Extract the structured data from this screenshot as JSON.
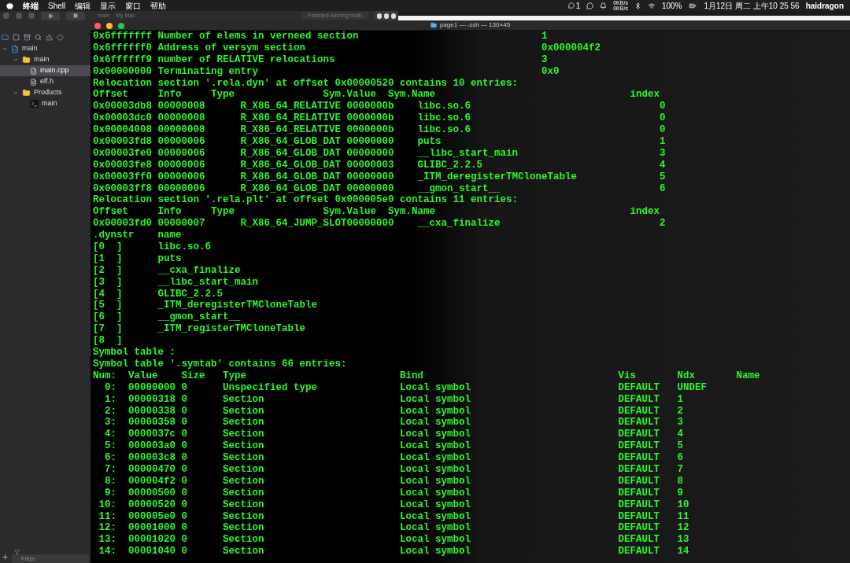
{
  "menu_bar": {
    "menus": [
      "终端",
      "Shell",
      "编辑",
      "显示",
      "窗口",
      "帮助"
    ],
    "badge": "1",
    "net_up": "0KB/s",
    "net_down": "0KB/s",
    "battery": "100%",
    "clock": "1月12日 周二 上午10 25 56",
    "user": "haidragon"
  },
  "xcode_toolbar": {
    "scheme": "main",
    "destination": "My Mac",
    "status": "Finished running main"
  },
  "navigator": {
    "tree": [
      {
        "label": "main",
        "kind": "project",
        "selected": false,
        "expanded": true,
        "children": [
          {
            "label": "main",
            "kind": "folder",
            "selected": false,
            "expanded": true,
            "children": [
              {
                "label": "main.cpp",
                "kind": "cpp",
                "selected": true
              },
              {
                "label": "elf.h",
                "kind": "header",
                "selected": false
              }
            ]
          },
          {
            "label": "Products",
            "kind": "folder",
            "selected": false,
            "expanded": true,
            "children": [
              {
                "label": "main",
                "kind": "executable",
                "selected": false
              }
            ]
          }
        ]
      }
    ],
    "filter": {
      "placeholder": "Filter"
    }
  },
  "terminal": {
    "title": "page1 — -zsh — 130×45",
    "blocks": [
      {
        "kind": "dynamic",
        "rows": [
          [
            "0x6fffffff",
            "Number of elems in verneed section",
            "1"
          ],
          [
            "0x6ffffff0",
            "Address of versym section",
            "0x000004f2"
          ],
          [
            "0x6ffffff9",
            "number of RELATIVE relocations",
            "3"
          ],
          [
            "0x00000000",
            "Terminating entry",
            "0x0"
          ]
        ]
      },
      {
        "kind": "heading",
        "text": "Relocation section '.rela.dyn' at offset 0x00000520 contains 10 entries:"
      },
      {
        "kind": "reloc",
        "header": [
          "Offset",
          "Info",
          "Type",
          "Sym.Value",
          "Sym.Name",
          "index"
        ],
        "rows": [
          [
            "0x00003db8",
            "00000008",
            "R_X86_64_RELATIVE",
            "0000000b",
            "libc.so.6",
            "0"
          ],
          [
            "0x00003dc0",
            "00000008",
            "R_X86_64_RELATIVE",
            "0000000b",
            "libc.so.6",
            "0"
          ],
          [
            "0x00004008",
            "00000008",
            "R_X86_64_RELATIVE",
            "0000000b",
            "libc.so.6",
            "0"
          ],
          [
            "0x00003fd8",
            "00000006",
            "R_X86_64_GLOB_DAT",
            "00000000",
            "puts",
            "1"
          ],
          [
            "0x00003fe0",
            "00000006",
            "R_X86_64_GLOB_DAT",
            "00000000",
            "__libc_start_main",
            "3"
          ],
          [
            "0x00003fe8",
            "00000006",
            "R_X86_64_GLOB_DAT",
            "00000003",
            "GLIBC_2.2.5",
            "4"
          ],
          [
            "0x00003ff0",
            "00000006",
            "R_X86_64_GLOB_DAT",
            "00000000",
            "_ITM_deregisterTMCloneTable",
            "5"
          ],
          [
            "0x00003ff8",
            "00000006",
            "R_X86_64_GLOB_DAT",
            "00000000",
            "__gmon_start__",
            "6"
          ]
        ]
      },
      {
        "kind": "heading",
        "text": "Relocation section '.rela.plt' at offset 0x000005e0 contains 11 entries:"
      },
      {
        "kind": "reloc",
        "header": [
          "Offset",
          "Info",
          "Type",
          "Sym.Value",
          "Sym.Name",
          "index"
        ],
        "rows": [
          [
            "0x00003fd0",
            "00000007",
            "R_X86_64_JUMP_SLOT",
            "00000000",
            "__cxa_finalize",
            "2"
          ]
        ]
      },
      {
        "kind": "dynstr",
        "header": [
          ".dynstr",
          "name"
        ],
        "rows": [
          [
            "[0  ]",
            "libc.so.6"
          ],
          [
            "[1  ]",
            "puts"
          ],
          [
            "[2  ]",
            "__cxa_finalize"
          ],
          [
            "[3  ]",
            "__libc_start_main"
          ],
          [
            "[4  ]",
            "GLIBC_2.2.5"
          ],
          [
            "[5  ]",
            "_ITM_deregisterTMCloneTable"
          ],
          [
            "[6  ]",
            "__gmon_start__"
          ],
          [
            "[7  ]",
            "_ITM_registerTMCloneTable"
          ],
          [
            "[8  ]"
          ]
        ]
      },
      {
        "kind": "heading",
        "text": "Symbol table :"
      },
      {
        "kind": "heading",
        "text": "Symbol table '.symtab' contains 66 entries:"
      },
      {
        "kind": "symtab",
        "header": [
          "Num:",
          "Value",
          "Size",
          "Type",
          "Bind",
          "Vis",
          "Ndx",
          "Name"
        ],
        "rows": [
          [
            "0:",
            "00000000",
            "0",
            "Unspecified type",
            "Local symbol",
            "DEFAULT",
            "UNDEF"
          ],
          [
            "1:",
            "00000318",
            "0",
            "Section",
            "Local symbol",
            "DEFAULT",
            "1"
          ],
          [
            "2:",
            "00000338",
            "0",
            "Section",
            "Local symbol",
            "DEFAULT",
            "2"
          ],
          [
            "3:",
            "00000358",
            "0",
            "Section",
            "Local symbol",
            "DEFAULT",
            "3"
          ],
          [
            "4:",
            "0000037c",
            "0",
            "Section",
            "Local symbol",
            "DEFAULT",
            "4"
          ],
          [
            "5:",
            "000003a0",
            "0",
            "Section",
            "Local symbol",
            "DEFAULT",
            "5"
          ],
          [
            "6:",
            "000003c8",
            "0",
            "Section",
            "Local symbol",
            "DEFAULT",
            "6"
          ],
          [
            "7:",
            "00000470",
            "0",
            "Section",
            "Local symbol",
            "DEFAULT",
            "7"
          ],
          [
            "8:",
            "000004f2",
            "0",
            "Section",
            "Local symbol",
            "DEFAULT",
            "8"
          ],
          [
            "9:",
            "00000500",
            "0",
            "Section",
            "Local symbol",
            "DEFAULT",
            "9"
          ],
          [
            "10:",
            "00000520",
            "0",
            "Section",
            "Local symbol",
            "DEFAULT",
            "10"
          ],
          [
            "11:",
            "000005e0",
            "0",
            "Section",
            "Local symbol",
            "DEFAULT",
            "11"
          ],
          [
            "12:",
            "00001000",
            "0",
            "Section",
            "Local symbol",
            "DEFAULT",
            "12"
          ],
          [
            "13:",
            "00001020",
            "0",
            "Section",
            "Local symbol",
            "DEFAULT",
            "13"
          ],
          [
            "14:",
            "00001040",
            "0",
            "Section",
            "Local symbol",
            "DEFAULT",
            "14"
          ]
        ]
      }
    ]
  }
}
